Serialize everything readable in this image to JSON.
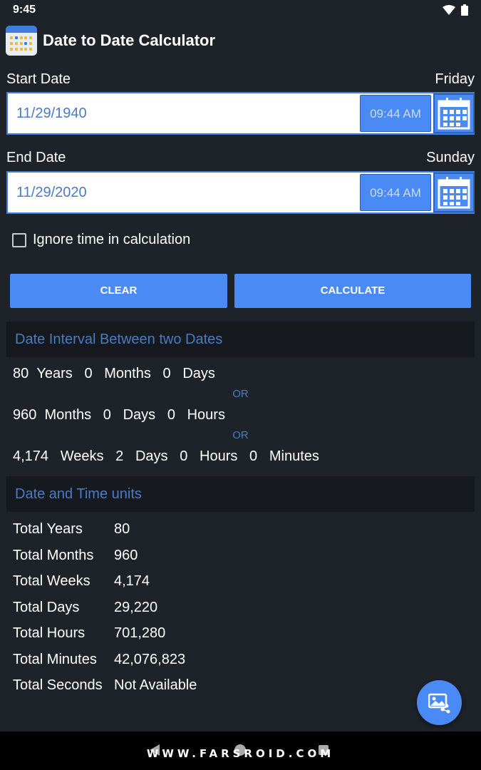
{
  "status_bar": {
    "time": "9:45"
  },
  "app": {
    "title": "Date to Date Calculator"
  },
  "start": {
    "label": "Start Date",
    "weekday": "Friday",
    "date": "11/29/1940",
    "time": "09:44 AM"
  },
  "end": {
    "label": "End Date",
    "weekday": "Sunday",
    "date": "11/29/2020",
    "time": "09:44 AM"
  },
  "ignore_time": {
    "label": "Ignore time in calculation",
    "checked": false
  },
  "buttons": {
    "clear": "CLEAR",
    "calculate": "CALCULATE"
  },
  "interval": {
    "header": "Date Interval Between two Dates",
    "or_label": "OR",
    "line1": [
      "80",
      "Years",
      "0",
      "Months",
      "0",
      "Days"
    ],
    "line2": [
      "960",
      "Months",
      "0",
      "Days",
      "0",
      "Hours"
    ],
    "line3": [
      "4,174",
      "Weeks",
      "2",
      "Days",
      "0",
      "Hours",
      "0",
      "Minutes"
    ]
  },
  "units": {
    "header": "Date and Time units",
    "rows": [
      {
        "label": "Total Years",
        "value": "80"
      },
      {
        "label": "Total Months",
        "value": "960"
      },
      {
        "label": "Total Weeks",
        "value": "4,174"
      },
      {
        "label": "Total Days",
        "value": "29,220"
      },
      {
        "label": "Total Hours",
        "value": "701,280"
      },
      {
        "label": "Total Minutes",
        "value": "42,076,823"
      },
      {
        "label": "Total Seconds",
        "value": "Not Available"
      }
    ]
  },
  "watermark": "WWW.FARSROID.COM",
  "colors": {
    "background": "#1e2329",
    "accent": "#4a8af4",
    "header_text": "#4a7bc4"
  }
}
